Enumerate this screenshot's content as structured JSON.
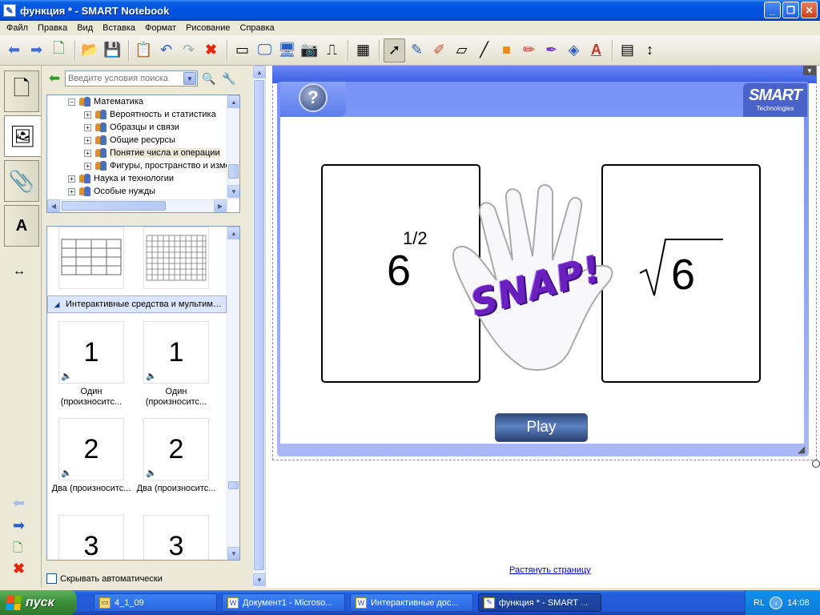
{
  "window": {
    "title": "функция * - SMART Notebook",
    "minimize": "_",
    "maximize": "❐",
    "close": "✕"
  },
  "menu": [
    "Файл",
    "Правка",
    "Вид",
    "Вставка",
    "Формат",
    "Рисование",
    "Справка"
  ],
  "toolbar_icons": [
    "back-arrow-icon",
    "forward-arrow-icon",
    "add-page-icon",
    "open-folder-icon",
    "save-icon",
    "paste-icon",
    "undo-icon",
    "redo-icon",
    "delete-icon",
    "screen-shade-icon",
    "show-board-icon",
    "full-screen-icon",
    "capture-icon",
    "document-camera-icon",
    "table-icon",
    "select-icon",
    "pen-icon",
    "creative-pen-icon",
    "eraser-icon",
    "line-icon",
    "shapes-icon",
    "magic-pen-icon",
    "highlighter-icon",
    "fill-icon",
    "text-icon",
    "properties-icon",
    "move-toolbar-icon"
  ],
  "gallery": {
    "search_placeholder": "Введите условия поиска",
    "tree": [
      {
        "label": "Математика",
        "expanded": true,
        "indent": 0
      },
      {
        "label": "Вероятность и статистика",
        "indent": 1
      },
      {
        "label": "Образцы и связи",
        "indent": 1
      },
      {
        "label": "Общие ресурсы",
        "indent": 1
      },
      {
        "label": "Понятие числа и операции",
        "indent": 1,
        "selected": true
      },
      {
        "label": "Фигуры, пространство и измерения",
        "indent": 1
      },
      {
        "label": "Наука и технологии",
        "indent": 0
      },
      {
        "label": "Особые нужды",
        "indent": 0
      }
    ],
    "category": "Интерактивные средства и мультимедиа",
    "items": [
      {
        "num": "1",
        "caption": "Один (произноситс..."
      },
      {
        "num": "1",
        "caption": "Один (произноситс..."
      },
      {
        "num": "2",
        "caption": "Два (произноситс..."
      },
      {
        "num": "2",
        "caption": "Два (произноситс..."
      },
      {
        "num": "3",
        "caption": ""
      },
      {
        "num": "3",
        "caption": ""
      }
    ],
    "autohide": "Скрывать автоматически"
  },
  "widget": {
    "help": "?",
    "logo_main": "SMART",
    "logo_sub": "Technologies",
    "left_card": {
      "base": "6",
      "exponent": "1/2"
    },
    "right_card": {
      "radicand": "6",
      "radical": "√"
    },
    "snap": "SNAP!",
    "play": "Play"
  },
  "stretch_link": "Растянуть страницу",
  "taskbar": {
    "start": "пуск",
    "tasks": [
      {
        "label": "4_1_09",
        "active": false
      },
      {
        "label": "Документ1 - Microso...",
        "active": false
      },
      {
        "label": "Интерактивные дос...",
        "active": false
      },
      {
        "label": "функция * - SMART ...",
        "active": true
      }
    ],
    "lang": "RL",
    "time": "14:08"
  }
}
